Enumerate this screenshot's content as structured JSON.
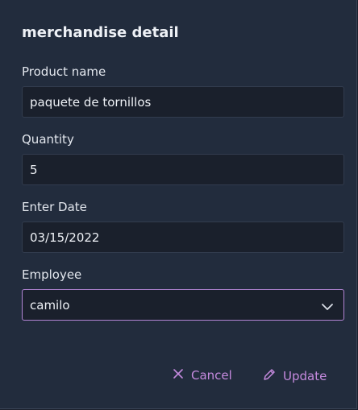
{
  "dialog": {
    "title": "merchandise detail"
  },
  "form": {
    "product_name": {
      "label": "Product name",
      "value": "paquete de tornillos"
    },
    "quantity": {
      "label": "Quantity",
      "value": "5"
    },
    "enter_date": {
      "label": "Enter Date",
      "value": "03/15/2022"
    },
    "employee": {
      "label": "Employee",
      "value": "camilo",
      "icon": "chevron-down-icon"
    }
  },
  "actions": {
    "cancel_label": "Cancel",
    "cancel_icon": "close-icon",
    "update_label": "Update",
    "update_icon": "pencil-icon"
  },
  "colors": {
    "accent": "#c58ade",
    "focus_border": "#b285d4",
    "dialog_bg": "#222c3d",
    "field_bg": "#1a202c"
  }
}
